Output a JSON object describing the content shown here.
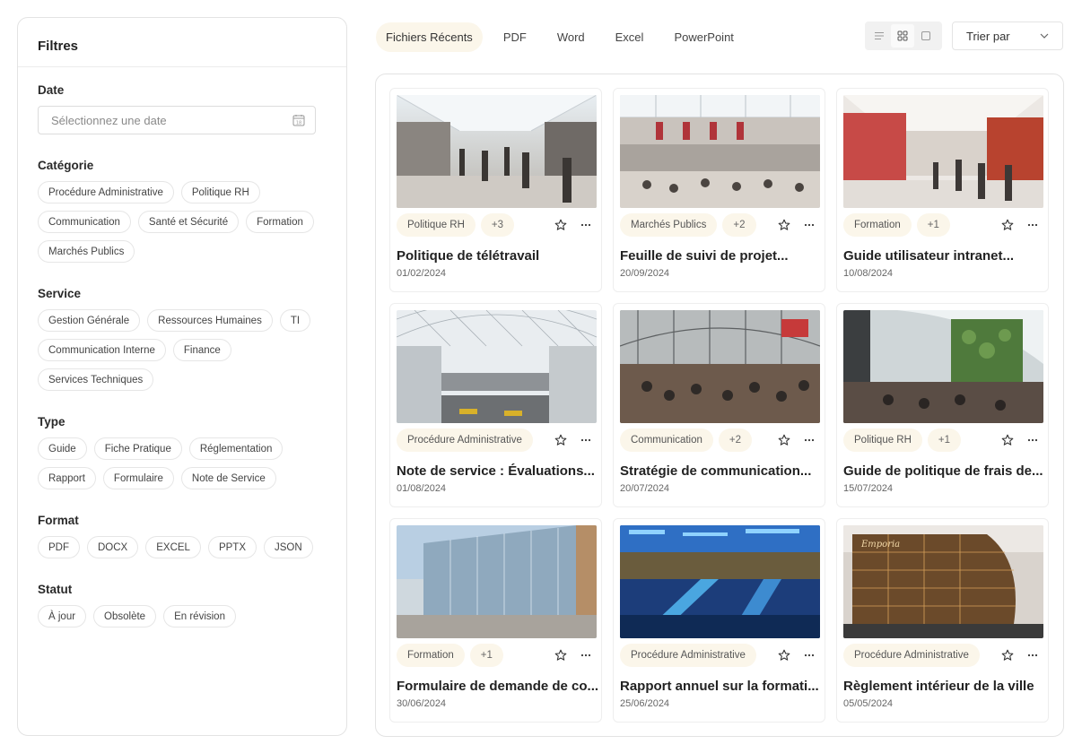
{
  "sidebar": {
    "title": "Filtres",
    "date": {
      "label": "Date",
      "placeholder": "Sélectionnez une date"
    },
    "categorie": {
      "label": "Catégorie",
      "chips": [
        "Procédure Administrative",
        "Politique RH",
        "Communication",
        "Santé et Sécurité",
        "Formation",
        "Marchés Publics"
      ]
    },
    "service": {
      "label": "Service",
      "chips": [
        "Gestion Générale",
        "Ressources Humaines",
        "TI",
        "Communication Interne",
        "Finance",
        "Services Techniques"
      ]
    },
    "type": {
      "label": "Type",
      "chips": [
        "Guide",
        "Fiche Pratique",
        "Réglementation",
        "Rapport",
        "Formulaire",
        "Note de Service"
      ]
    },
    "format": {
      "label": "Format",
      "chips": [
        "PDF",
        "DOCX",
        "EXCEL",
        "PPTX",
        "JSON"
      ]
    },
    "statut": {
      "label": "Statut",
      "chips": [
        "À jour",
        "Obsolète",
        "En révision"
      ]
    }
  },
  "tabs": [
    "Fichiers Récents",
    "PDF",
    "Word",
    "Excel",
    "PowerPoint"
  ],
  "active_tab": "Fichiers Récents",
  "view_modes": [
    "list-icon",
    "grid-icon",
    "single-icon"
  ],
  "active_view": "grid-icon",
  "sort": {
    "label": "Trier par"
  },
  "colors": {
    "accent_bg": "#fbf6ea",
    "border": "#e3e3e3"
  },
  "cards": [
    {
      "tag": "Politique RH",
      "extra": "+3",
      "title": "Politique de télétravail",
      "date": "01/02/2024",
      "scene": "mall-skylight"
    },
    {
      "tag": "Marchés Publics",
      "extra": "+2",
      "title": "Feuille de suivi de projet...",
      "date": "20/09/2024",
      "scene": "mall-atrium"
    },
    {
      "tag": "Formation",
      "extra": "+1",
      "title": "Guide utilisateur intranet...",
      "date": "10/08/2024",
      "scene": "mall-shops"
    },
    {
      "tag": "Procédure Administrative",
      "extra": "",
      "title": "Note de service : Évaluations...",
      "date": "01/08/2024",
      "scene": "glass-dome"
    },
    {
      "tag": "Communication",
      "extra": "+2",
      "title": "Stratégie de communication...",
      "date": "20/07/2024",
      "scene": "food-court"
    },
    {
      "tag": "Politique RH",
      "extra": "+1",
      "title": "Guide de politique de frais de...",
      "date": "15/07/2024",
      "scene": "green-wall"
    },
    {
      "tag": "Formation",
      "extra": "+1",
      "title": "Formulaire de demande de co...",
      "date": "30/06/2024",
      "scene": "glass-building"
    },
    {
      "tag": "Procédure Administrative",
      "extra": "",
      "title": "Rapport annuel sur la formati...",
      "date": "25/06/2024",
      "scene": "blue-escalators"
    },
    {
      "tag": "Procédure Administrative",
      "extra": "",
      "title": "Règlement intérieur de la ville",
      "date": "05/05/2024",
      "scene": "night-facade"
    }
  ]
}
